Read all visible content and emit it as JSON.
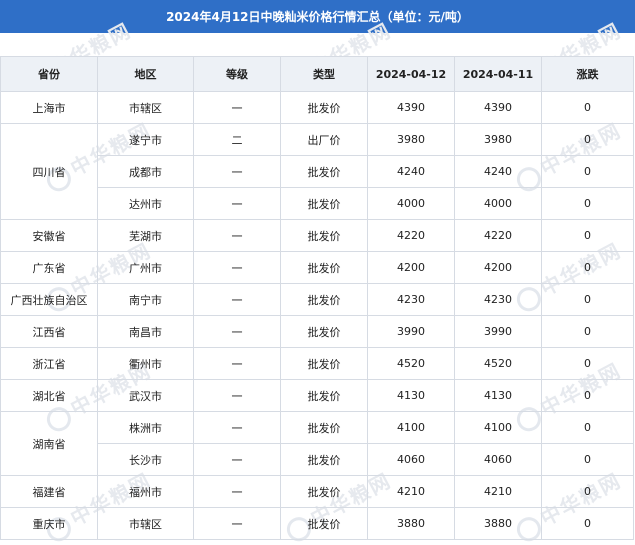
{
  "title": "2024年4月12日中晚籼米价格行情汇总（单位：元/吨）",
  "watermark": "中华粮网",
  "columns": [
    "省份",
    "地区",
    "等级",
    "类型",
    "2024-04-12",
    "2024-04-11",
    "涨跌"
  ],
  "rows": [
    {
      "province": "上海市",
      "region": "市辖区",
      "grade": "一",
      "type": "批发价",
      "price_0412": "4390",
      "price_0411": "4390",
      "change": "0"
    },
    {
      "province": "四川省",
      "region": "遂宁市",
      "grade": "二",
      "type": "出厂价",
      "price_0412": "3980",
      "price_0411": "3980",
      "change": "0"
    },
    {
      "province": "",
      "region": "成都市",
      "grade": "一",
      "type": "批发价",
      "price_0412": "4240",
      "price_0411": "4240",
      "change": "0"
    },
    {
      "province": "",
      "region": "达州市",
      "grade": "一",
      "type": "批发价",
      "price_0412": "4000",
      "price_0411": "4000",
      "change": "0"
    },
    {
      "province": "安徽省",
      "region": "芜湖市",
      "grade": "一",
      "type": "批发价",
      "price_0412": "4220",
      "price_0411": "4220",
      "change": "0"
    },
    {
      "province": "广东省",
      "region": "广州市",
      "grade": "一",
      "type": "批发价",
      "price_0412": "4200",
      "price_0411": "4200",
      "change": "0"
    },
    {
      "province": "广西壮族自治区",
      "region": "南宁市",
      "grade": "一",
      "type": "批发价",
      "price_0412": "4230",
      "price_0411": "4230",
      "change": "0"
    },
    {
      "province": "江西省",
      "region": "南昌市",
      "grade": "一",
      "type": "批发价",
      "price_0412": "3990",
      "price_0411": "3990",
      "change": "0"
    },
    {
      "province": "浙江省",
      "region": "衢州市",
      "grade": "一",
      "type": "批发价",
      "price_0412": "4520",
      "price_0411": "4520",
      "change": "0"
    },
    {
      "province": "湖北省",
      "region": "武汉市",
      "grade": "一",
      "type": "批发价",
      "price_0412": "4130",
      "price_0411": "4130",
      "change": "0"
    },
    {
      "province": "湖南省",
      "region": "株洲市",
      "grade": "一",
      "type": "批发价",
      "price_0412": "4100",
      "price_0411": "4100",
      "change": "0"
    },
    {
      "province": "",
      "region": "长沙市",
      "grade": "一",
      "type": "批发价",
      "price_0412": "4060",
      "price_0411": "4060",
      "change": "0"
    },
    {
      "province": "福建省",
      "region": "福州市",
      "grade": "一",
      "type": "批发价",
      "price_0412": "4210",
      "price_0411": "4210",
      "change": "0"
    },
    {
      "province": "重庆市",
      "region": "市辖区",
      "grade": "一",
      "type": "批发价",
      "price_0412": "3880",
      "price_0411": "3880",
      "change": "0"
    }
  ]
}
